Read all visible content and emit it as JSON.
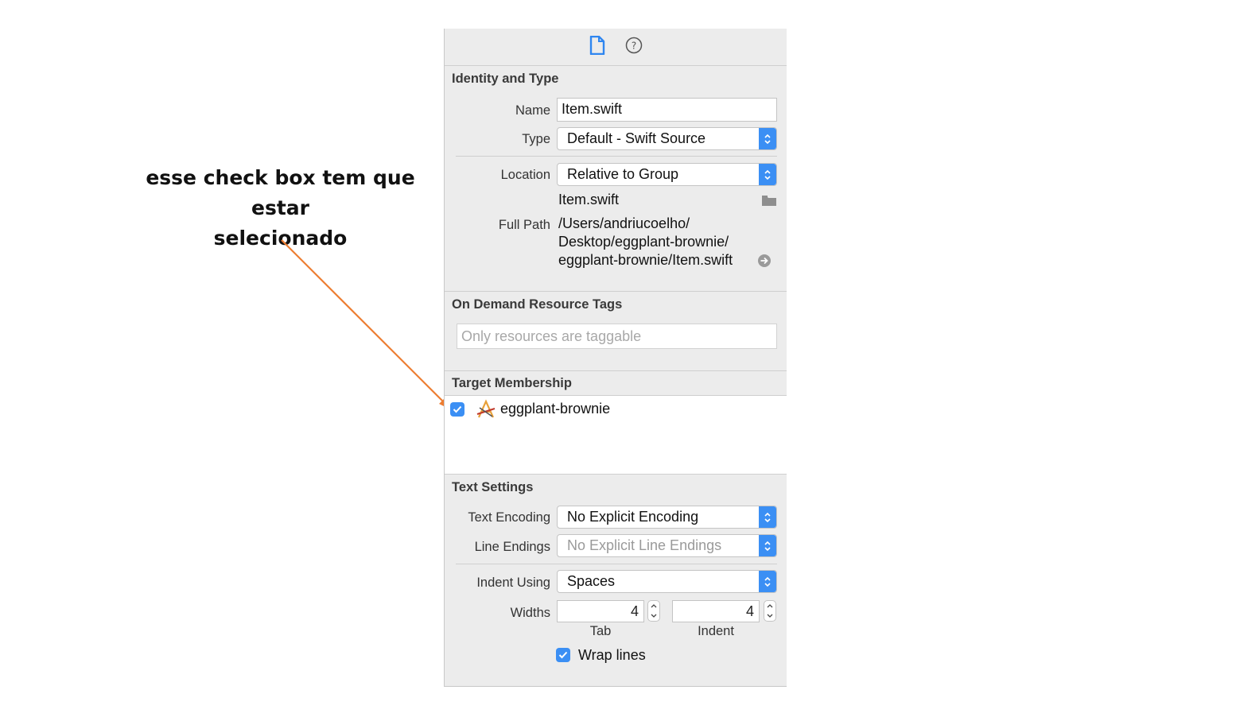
{
  "annotation": {
    "line1": "esse check box tem que estar",
    "line2": "selecionado",
    "arrow_color": "#ed7d31"
  },
  "inspector": {
    "tabs": [
      {
        "icon": "file-icon",
        "selected": true
      },
      {
        "icon": "help-icon",
        "selected": false
      }
    ],
    "identity": {
      "title": "Identity and Type",
      "name_label": "Name",
      "name_value": "Item.swift",
      "type_label": "Type",
      "type_value": "Default - Swift Source",
      "location_label": "Location",
      "location_value": "Relative to Group",
      "location_file": "Item.swift",
      "fullpath_label": "Full Path",
      "fullpath_line1": "/Users/andriucoelho/",
      "fullpath_line2": "Desktop/eggplant-brownie/",
      "fullpath_line3": "eggplant-brownie/Item.swift"
    },
    "tags": {
      "title": "On Demand Resource Tags",
      "placeholder": "Only resources are taggable"
    },
    "membership": {
      "title": "Target Membership",
      "target_name": "eggplant-brownie",
      "checked": true
    },
    "text_settings": {
      "title": "Text Settings",
      "encoding_label": "Text Encoding",
      "encoding_value": "No Explicit Encoding",
      "line_endings_label": "Line Endings",
      "line_endings_value": "No Explicit Line Endings",
      "indent_using_label": "Indent Using",
      "indent_using_value": "Spaces",
      "widths_label": "Widths",
      "tab_width": "4",
      "indent_width": "4",
      "tab_label": "Tab",
      "indent_label": "Indent",
      "wrap_label": "Wrap lines",
      "wrap_checked": true
    }
  },
  "colors": {
    "accent": "#3b8ff4",
    "panel_bg": "#ececec"
  }
}
